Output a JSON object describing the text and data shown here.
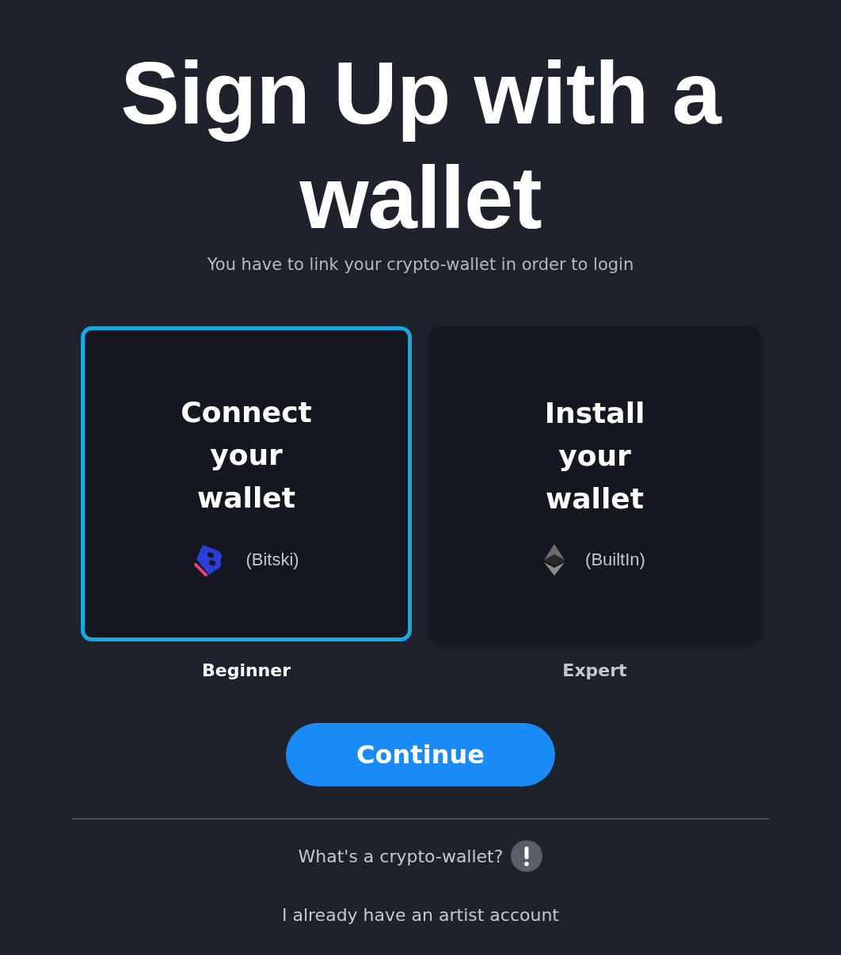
{
  "title": "Sign Up with a wallet",
  "subtitle": "You have to link your crypto-wallet in order to login",
  "options": [
    {
      "title": "Connect your wallet",
      "provider": "(Bitski)",
      "kind": "bitski",
      "level_label": "Beginner",
      "selected": true
    },
    {
      "title": "Install your wallet",
      "provider": "(BuiltIn)",
      "kind": "ethereum",
      "level_label": "Expert",
      "selected": false
    }
  ],
  "continue_button": "Continue",
  "help_link": "What's a crypto-wallet?",
  "account_link": "I already have an artist account"
}
